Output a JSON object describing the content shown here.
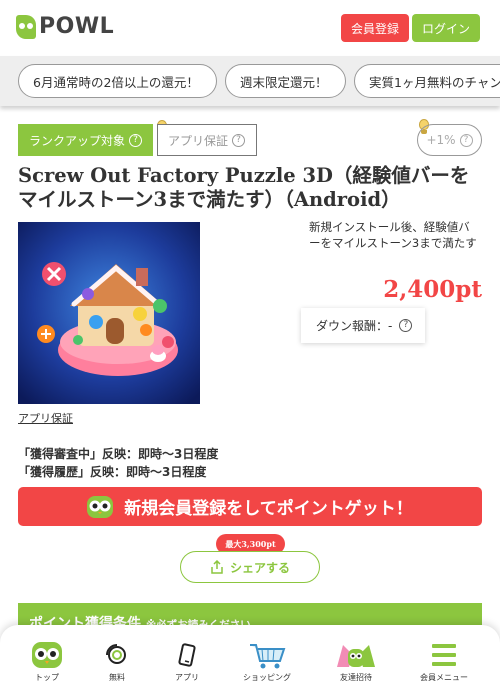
{
  "header": {
    "logo_text": "POWL",
    "register_label": "会員登録",
    "login_label": "ログイン"
  },
  "campaign_tabs": [
    {
      "label": "6月通常時の2倍以上の還元！"
    },
    {
      "label": "週末限定還元！"
    },
    {
      "label": "実質1ヶ月無料のチャン"
    }
  ],
  "badges": {
    "rank_up": "ランクアップ対象",
    "app_guarantee": "アプリ保証",
    "plus_rate": "+1%"
  },
  "offer": {
    "title": "Screw Out Factory Puzzle 3D（経験値バーをマイルストーン3まで満たす）（Android）",
    "description": "新規インストール後、経験値バーをマイルストーン3まで満たす",
    "points": "2,400pt",
    "down_reward": "ダウン報酬：-",
    "app_guarantee_link": "アプリ保証",
    "reflect_lines": [
      "「獲得審査中」反映：即時～3日程度",
      "「獲得履歴」反映：即時～3日程度"
    ]
  },
  "cta": {
    "label": "新規会員登録をしてポイントゲット！"
  },
  "share": {
    "badge": "最大3,300pt",
    "label": "シェアする"
  },
  "conditions": {
    "title": "ポイント獲得条件",
    "note": "※必ずお読みください"
  },
  "bottom_nav": [
    {
      "label": "トップ",
      "icon": "owl-icon"
    },
    {
      "label": "無料",
      "icon": "free-coin-icon"
    },
    {
      "label": "アプリ",
      "icon": "smartphone-icon"
    },
    {
      "label": "ショッピング",
      "icon": "shopping-cart-icon"
    },
    {
      "label": "友達招待",
      "icon": "friends-icon"
    },
    {
      "label": "会員メニュー",
      "icon": "menu-icon"
    }
  ],
  "colors": {
    "brand_green": "#8cc63f",
    "accent_red": "#f24646"
  }
}
